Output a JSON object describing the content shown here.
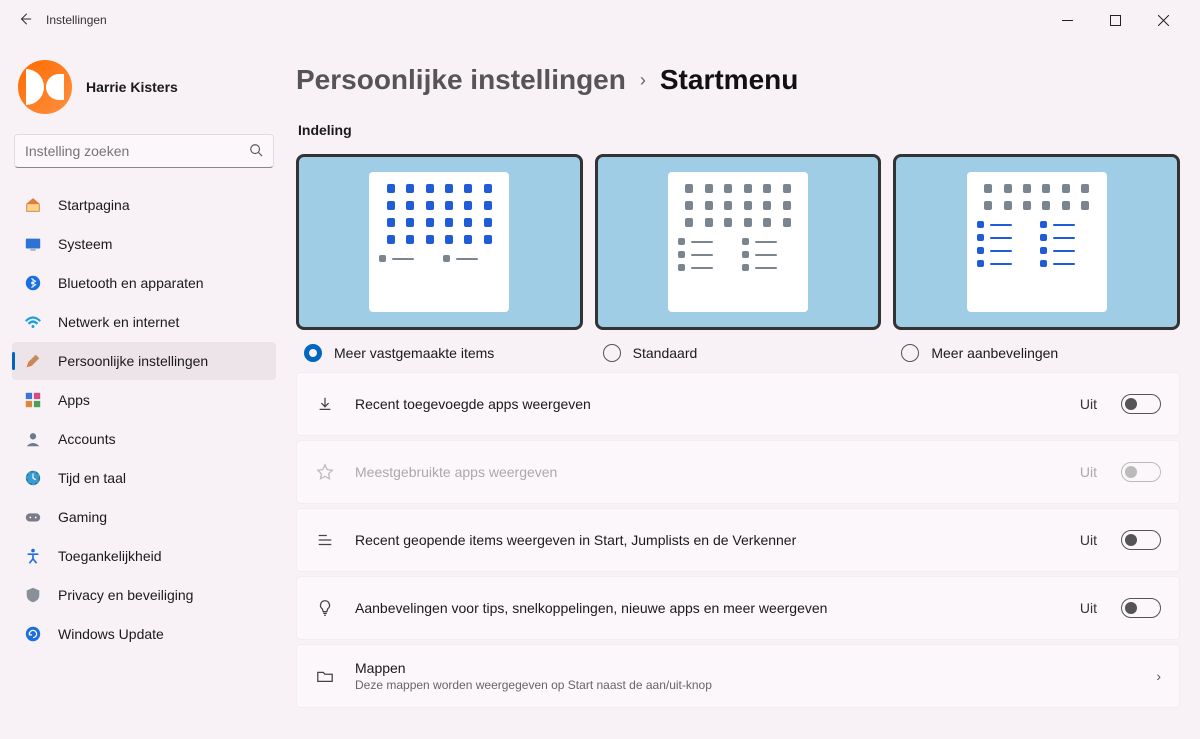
{
  "titlebar": {
    "title": "Instellingen"
  },
  "user": {
    "name": "Harrie Kisters"
  },
  "search": {
    "placeholder": "Instelling zoeken"
  },
  "nav": {
    "items": [
      {
        "label": "Startpagina"
      },
      {
        "label": "Systeem"
      },
      {
        "label": "Bluetooth en apparaten"
      },
      {
        "label": "Netwerk en internet"
      },
      {
        "label": "Persoonlijke instellingen"
      },
      {
        "label": "Apps"
      },
      {
        "label": "Accounts"
      },
      {
        "label": "Tijd en taal"
      },
      {
        "label": "Gaming"
      },
      {
        "label": "Toegankelijkheid"
      },
      {
        "label": "Privacy en beveiliging"
      },
      {
        "label": "Windows Update"
      }
    ]
  },
  "crumb": {
    "parent": "Persoonlijke instellingen",
    "current": "Startmenu"
  },
  "section_layout": "Indeling",
  "layout_options": [
    {
      "label": "Meer vastgemaakte items",
      "checked": true
    },
    {
      "label": "Standaard",
      "checked": false
    },
    {
      "label": "Meer aanbevelingen",
      "checked": false
    }
  ],
  "rows": [
    {
      "label": "Recent toegevoegde apps weergeven",
      "state": "Uit"
    },
    {
      "label": "Meestgebruikte apps weergeven",
      "state": "Uit"
    },
    {
      "label": "Recent geopende items weergeven in Start, Jumplists en de Verkenner",
      "state": "Uit"
    },
    {
      "label": "Aanbevelingen voor tips, snelkoppelingen, nieuwe apps en meer weergeven",
      "state": "Uit"
    },
    {
      "title": "Mappen",
      "sub": "Deze mappen worden weergegeven op Start naast de aan/uit-knop"
    }
  ]
}
